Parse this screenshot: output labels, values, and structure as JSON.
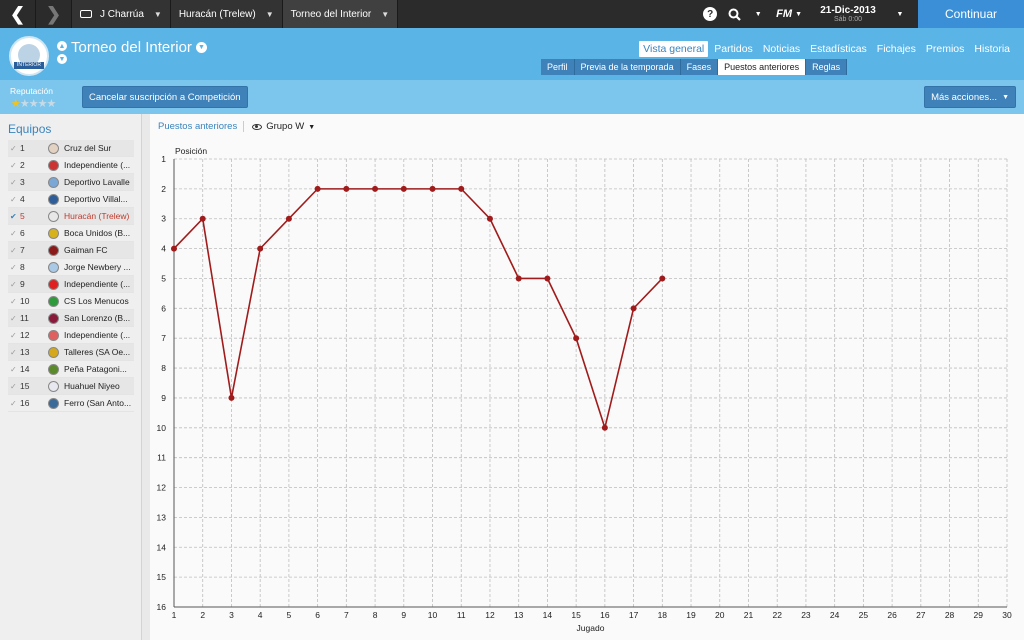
{
  "topbar": {
    "back_icon": "chevron-left-icon",
    "forward_icon": "chevron-right-icon",
    "crumbs": [
      {
        "label": "J Charrúa",
        "icon": "card-icon"
      },
      {
        "label": "Huracán (Trelew)"
      },
      {
        "label": "Torneo del Interior"
      }
    ],
    "help_icon": "help-icon",
    "search_icon": "search-icon",
    "fm_label": "FM",
    "date": "21-Dic-2013",
    "day": "Sáb 0:00",
    "continue_label": "Continuar"
  },
  "header": {
    "title": "Torneo del Interior",
    "badge_text": "INTERIOR",
    "main_tabs": [
      "Vista general",
      "Partidos",
      "Noticias",
      "Estadísticas",
      "Fichajes",
      "Premios",
      "Historia"
    ],
    "selected_main_tab": "Vista general",
    "sub_tabs": [
      "Perfil",
      "Previa de la temporada",
      "Fases",
      "Puestos anteriores",
      "Reglas"
    ],
    "selected_sub_tab": "Puestos anteriores"
  },
  "actionbar": {
    "reputation_label": "Reputación",
    "reputation_stars": 1,
    "reputation_max": 5,
    "cancel_label": "Cancelar suscripción a Competición",
    "more_label": "Más acciones..."
  },
  "sidebar": {
    "title": "Equipos",
    "teams": [
      {
        "pos": "1",
        "name": "Cruz del Sur",
        "color": "#e3d2c2"
      },
      {
        "pos": "2",
        "name": "Independiente (...",
        "color": "#cc3333"
      },
      {
        "pos": "3",
        "name": "Deportivo Lavalle",
        "color": "#7aa7d6"
      },
      {
        "pos": "4",
        "name": "Deportivo Villal...",
        "color": "#2f5d9a"
      },
      {
        "pos": "5",
        "name": "Huracán (Trelew)",
        "color": "#e8e8e8",
        "highlight": true
      },
      {
        "pos": "6",
        "name": "Boca Unidos (B...",
        "color": "#d8b21a"
      },
      {
        "pos": "7",
        "name": "Gaiman FC",
        "color": "#8b1a1a"
      },
      {
        "pos": "8",
        "name": "Jorge Newbery ...",
        "color": "#a9c9e6"
      },
      {
        "pos": "9",
        "name": "Independiente (...",
        "color": "#e02020"
      },
      {
        "pos": "10",
        "name": "CS Los Menucos",
        "color": "#2f9a3a"
      },
      {
        "pos": "11",
        "name": "San Lorenzo (B...",
        "color": "#8a1a3a"
      },
      {
        "pos": "12",
        "name": "Independiente (...",
        "color": "#e06060"
      },
      {
        "pos": "13",
        "name": "Talleres (SA Oe...",
        "color": "#d4a81a"
      },
      {
        "pos": "14",
        "name": "Peña Patagoni...",
        "color": "#5a8a2a"
      },
      {
        "pos": "15",
        "name": "Huahuel Niyeo",
        "color": "#e8e8f0"
      },
      {
        "pos": "16",
        "name": "Ferro (San Anto...",
        "color": "#3a6a9a"
      }
    ]
  },
  "panel": {
    "link_label": "Puestos anteriores",
    "group_icon": "eye-icon",
    "group_label": "Grupo W"
  },
  "chart_data": {
    "type": "line",
    "ylabel": "Posición",
    "xlabel": "Jugado",
    "xlim": [
      1,
      30
    ],
    "ylim": [
      1,
      16
    ],
    "y_inverted": true,
    "x_ticks": [
      1,
      2,
      3,
      4,
      5,
      6,
      7,
      8,
      9,
      10,
      11,
      12,
      13,
      14,
      15,
      16,
      17,
      18,
      19,
      20,
      21,
      22,
      23,
      24,
      25,
      26,
      27,
      28,
      29,
      30
    ],
    "y_ticks": [
      1,
      2,
      3,
      4,
      5,
      6,
      7,
      8,
      9,
      10,
      11,
      12,
      13,
      14,
      15,
      16
    ],
    "grid": true,
    "series": [
      {
        "color": "#a01c1c",
        "x": [
          1,
          2,
          3,
          4,
          5,
          6,
          7,
          8,
          9,
          10,
          11,
          12,
          13,
          14,
          15,
          16,
          17,
          18
        ],
        "values": [
          4,
          3,
          9,
          4,
          3,
          2,
          2,
          2,
          2,
          2,
          2,
          3,
          5,
          5,
          7,
          10,
          6,
          5
        ]
      }
    ]
  }
}
